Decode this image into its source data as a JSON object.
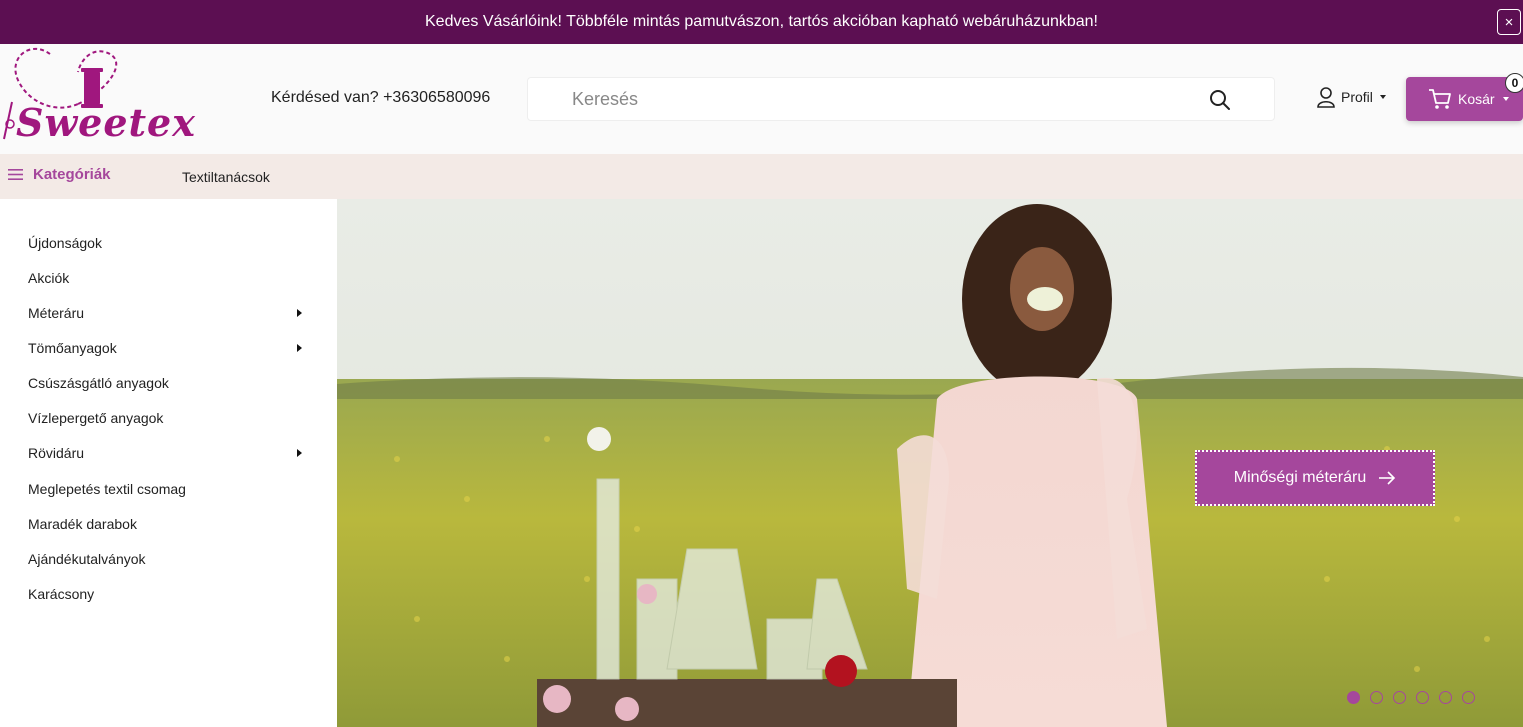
{
  "announcement": {
    "text": "Kedves Vásárlóink! Többféle mintás pamutvászon, tartós akcióban kapható webáruházunkban!",
    "close": "×"
  },
  "header": {
    "logo_text": "Sweetex",
    "contact": "Kérdésed van? +36306580096",
    "search_placeholder": "Keresés",
    "profile_label": "Profil",
    "cart_label": "Kosár",
    "cart_count": "0"
  },
  "nav": {
    "categories_label": "Kategóriák",
    "links": [
      "Textiltanácsok"
    ]
  },
  "sidebar": {
    "items": [
      {
        "label": "Újdonságok",
        "has_submenu": false
      },
      {
        "label": "Akciók",
        "has_submenu": false
      },
      {
        "label": "Méteráru",
        "has_submenu": true
      },
      {
        "label": "Tömőanyagok",
        "has_submenu": true
      },
      {
        "label": "Csúszásgátló anyagok",
        "has_submenu": false
      },
      {
        "label": "Vízlepergető anyagok",
        "has_submenu": false
      },
      {
        "label": "Rövidáru",
        "has_submenu": true
      },
      {
        "label": "Meglepetés textil csomag",
        "has_submenu": false
      },
      {
        "label": "Maradék darabok",
        "has_submenu": false
      },
      {
        "label": "Ajándékutalványok",
        "has_submenu": false
      },
      {
        "label": "Karácsony",
        "has_submenu": false
      }
    ]
  },
  "hero": {
    "button_label": "Minőségi méteráru",
    "slides_total": 6,
    "active_slide": 1
  },
  "colors": {
    "brand": "#a5479c",
    "topbar": "#5c0f52",
    "navbar": "#f3eae6"
  }
}
